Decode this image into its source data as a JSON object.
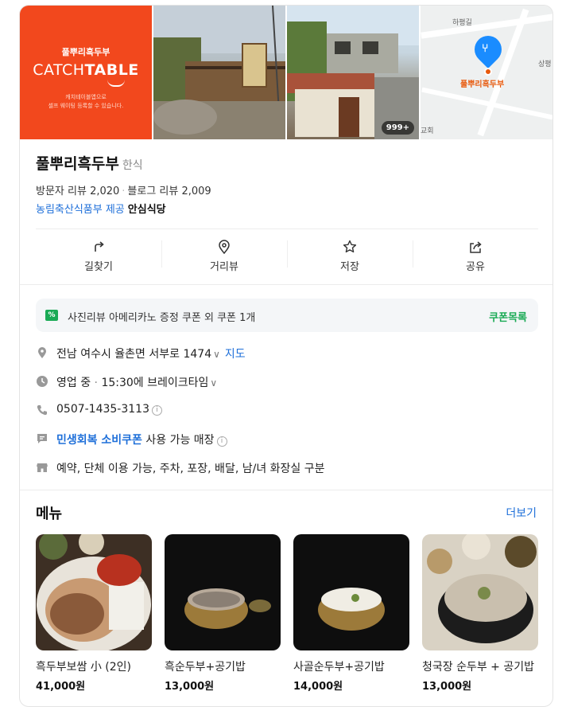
{
  "gallery": {
    "catchtable_top": "풀뿌리흑두부",
    "catchtable_logo_a": "CATCH",
    "catchtable_logo_b": "TABLE",
    "catchtable_sub1": "캐치테이블앱으로",
    "catchtable_sub2": "셀프 웨이팅 등록할 수 있습니다.",
    "photo_count": "999+",
    "map_label_top": "하평길",
    "map_label_right": "상평",
    "map_label_left": "교회",
    "map_place_name": "풀뿌리흑두부"
  },
  "place": {
    "name": "풀뿌리흑두부",
    "category": "한식",
    "visitor_reviews": "방문자 리뷰 2,020",
    "blog_reviews": "블로그 리뷰 2,009",
    "cert_provider": "농림축산식품부 제공",
    "cert_name": "안심식당"
  },
  "actions": [
    {
      "label": "길찾기",
      "icon": "directions-icon"
    },
    {
      "label": "거리뷰",
      "icon": "streetview-icon"
    },
    {
      "label": "저장",
      "icon": "star-icon"
    },
    {
      "label": "공유",
      "icon": "share-icon"
    }
  ],
  "coupon": {
    "text": "사진리뷰 아메리카노 증정 쿠폰 외 쿠폰 1개",
    "link": "쿠폰목록"
  },
  "info": {
    "address": "전남 여수시 율촌면 서부로 1474",
    "map_link": "지도",
    "status": "영업 중",
    "hours": "15:30에 브레이크타임",
    "phone": "0507-1435-3113",
    "coupon_label": "민생회복 소비쿠폰",
    "coupon_suffix": "사용 가능 매장",
    "amenities": "예약, 단체 이용 가능, 주차, 포장, 배달, 남/녀 화장실 구분"
  },
  "menu": {
    "title": "메뉴",
    "more": "더보기",
    "items": [
      {
        "name": "흑두부보쌈 小 (2인)",
        "price": "41,000원"
      },
      {
        "name": "흑순두부+공기밥",
        "price": "13,000원"
      },
      {
        "name": "사골순두부+공기밥",
        "price": "14,000원"
      },
      {
        "name": "청국장 순두부 + 공기밥",
        "price": "13,000원"
      }
    ]
  },
  "colors": {
    "catchtable": "#f2481d",
    "link_blue": "#1e6fd9",
    "coupon_green": "#1aaa55",
    "map_pin": "#1a8cff"
  }
}
